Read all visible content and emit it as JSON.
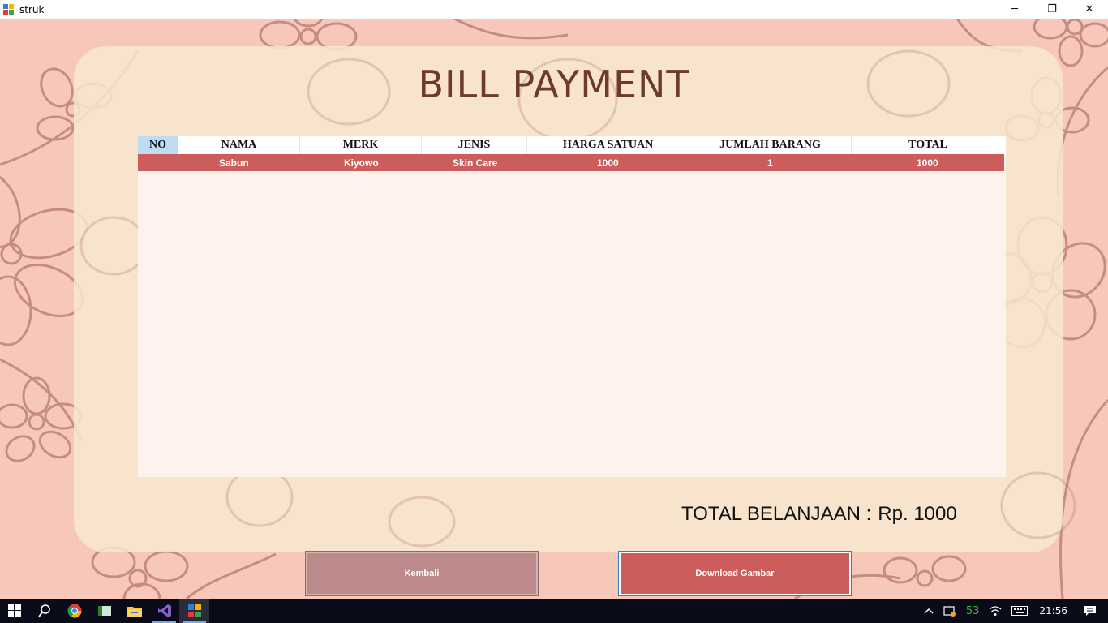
{
  "window": {
    "title": "struk",
    "minimize_glyph": "─",
    "restore_glyph": "❐",
    "close_glyph": "✕"
  },
  "page": {
    "title": "BILL PAYMENT"
  },
  "table": {
    "columns": [
      "NO",
      "NAMA",
      "MERK",
      "JENIS",
      "HARGA SATUAN",
      "JUMLAH BARANG",
      "TOTAL"
    ],
    "rows": [
      {
        "no": "",
        "nama": "Sabun",
        "merk": "Kiyowo",
        "jenis": "Skin Care",
        "harga_satuan": "1000",
        "jumlah_barang": "1",
        "total": "1000"
      }
    ]
  },
  "summary": {
    "label": "TOTAL BELANJAAN :",
    "value": "Rp. 1000"
  },
  "buttons": {
    "back": "Kembali",
    "download": "Download Gambar"
  },
  "colors": {
    "selected_row": "#cd5c5c",
    "back_button": "#bc8a8a",
    "download_button": "#cd5c5c",
    "title_text": "#6e3b2b"
  },
  "taskbar": {
    "apps": [
      "windows-start-icon",
      "search-icon",
      "chrome-icon",
      "app-icon",
      "file-explorer-icon",
      "visual-studio-icon",
      "struk-app-icon"
    ],
    "tray": {
      "temperature": "53",
      "time": "21:56"
    }
  }
}
